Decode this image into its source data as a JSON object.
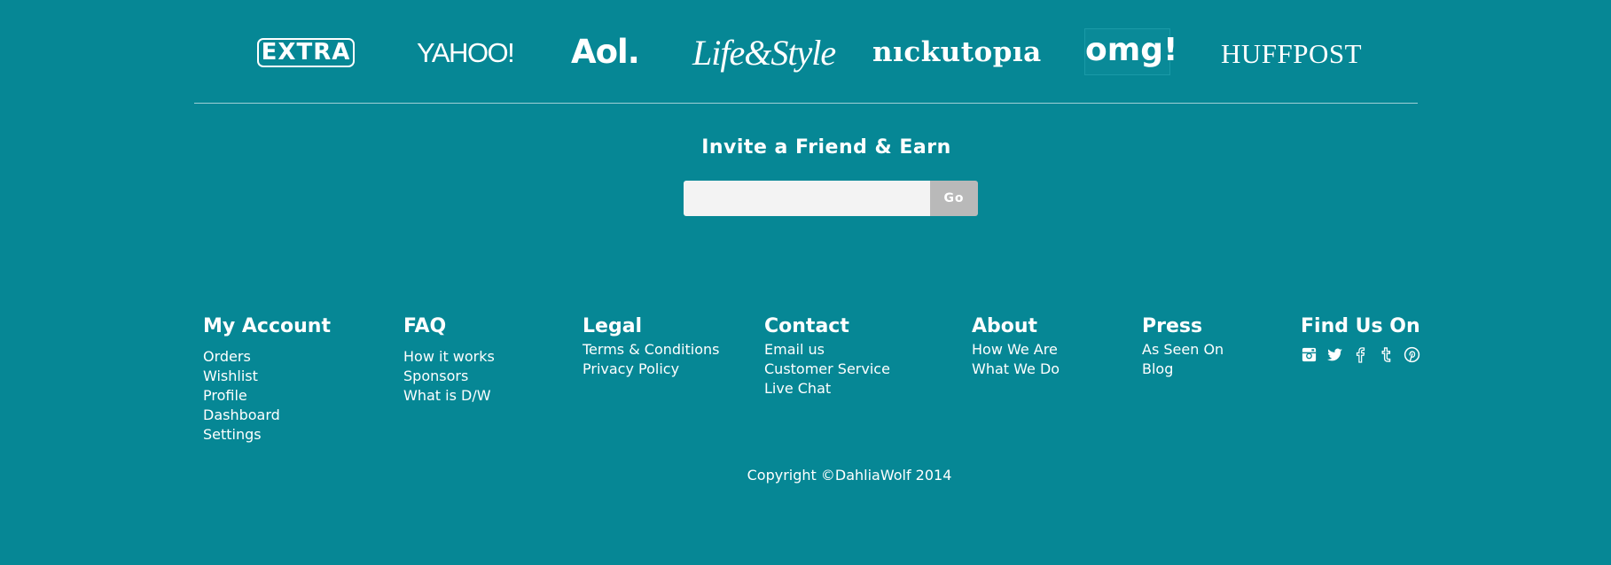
{
  "press_logos": {
    "extra": "EXTRA",
    "yahoo": "YAHOO!",
    "aol": "Aol.",
    "lifestyle": "Life&Style",
    "nickutopia": "nıckutopıa",
    "omg": "omg!",
    "huffpost": "HUFFPOST"
  },
  "invite": {
    "title": "Invite a Friend & Earn",
    "input_value": "",
    "button_label": "Go"
  },
  "footer": {
    "my_account": {
      "title": "My Account",
      "links": [
        "Orders",
        "Wishlist",
        "Profile",
        "Dashboard",
        "Settings"
      ]
    },
    "faq": {
      "title": "FAQ",
      "links": [
        "How it works",
        "Sponsors",
        "What is D/W"
      ]
    },
    "legal": {
      "title": "Legal",
      "links": [
        "Terms & Conditions",
        "Privacy Policy"
      ]
    },
    "contact": {
      "title": "Contact",
      "links": [
        "Email us",
        "Customer Service",
        "Live Chat"
      ]
    },
    "about": {
      "title": "About",
      "links": [
        "How We Are",
        "What We Do"
      ]
    },
    "press": {
      "title": "Press",
      "links": [
        "As Seen On",
        "Blog"
      ]
    },
    "find_us": {
      "title": "Find Us On",
      "icons": [
        "instagram-icon",
        "twitter-icon",
        "facebook-icon",
        "tumblr-icon",
        "pinterest-icon"
      ]
    }
  },
  "copyright": "Copyright ©DahliaWolf 2014",
  "colors": {
    "background": "#068795",
    "text": "#ffffff",
    "input_bg": "#f3f3f3",
    "button_bg": "#b9b9b9",
    "divider": "#9fd0d6"
  }
}
